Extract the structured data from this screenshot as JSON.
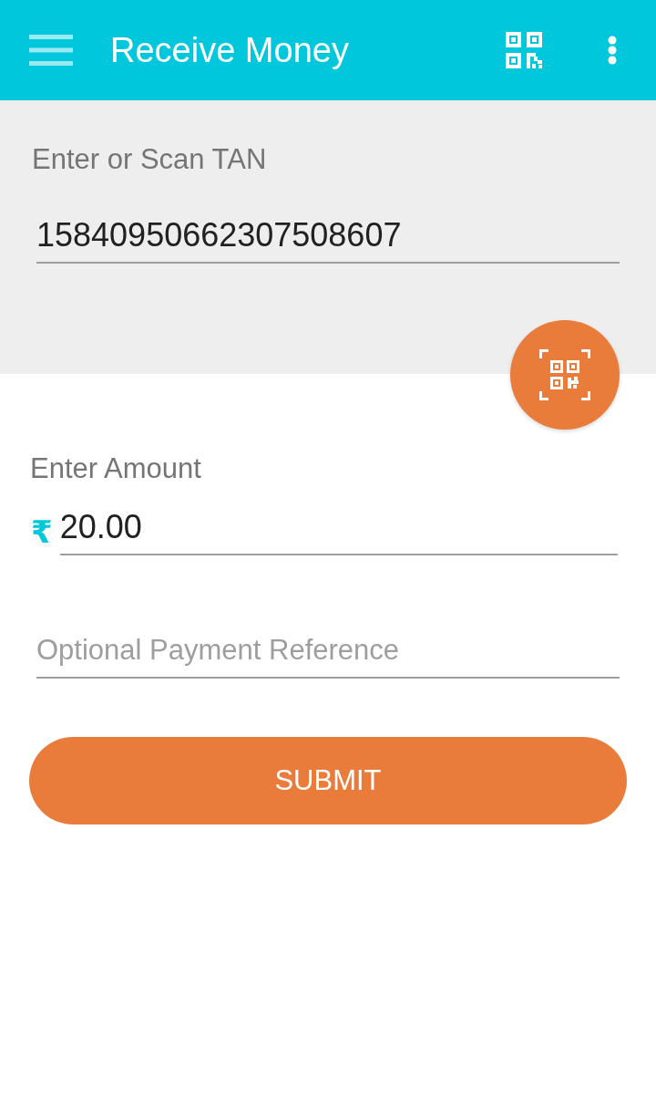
{
  "app_bar": {
    "title": "Receive Money"
  },
  "tan_section": {
    "label": "Enter or Scan TAN",
    "value": "15840950662307508607"
  },
  "amount": {
    "label": "Enter Amount",
    "currency_symbol": "₹",
    "value": "20.00"
  },
  "reference": {
    "placeholder": "Optional Payment Reference"
  },
  "submit_button": {
    "label": "SUBMIT"
  }
}
